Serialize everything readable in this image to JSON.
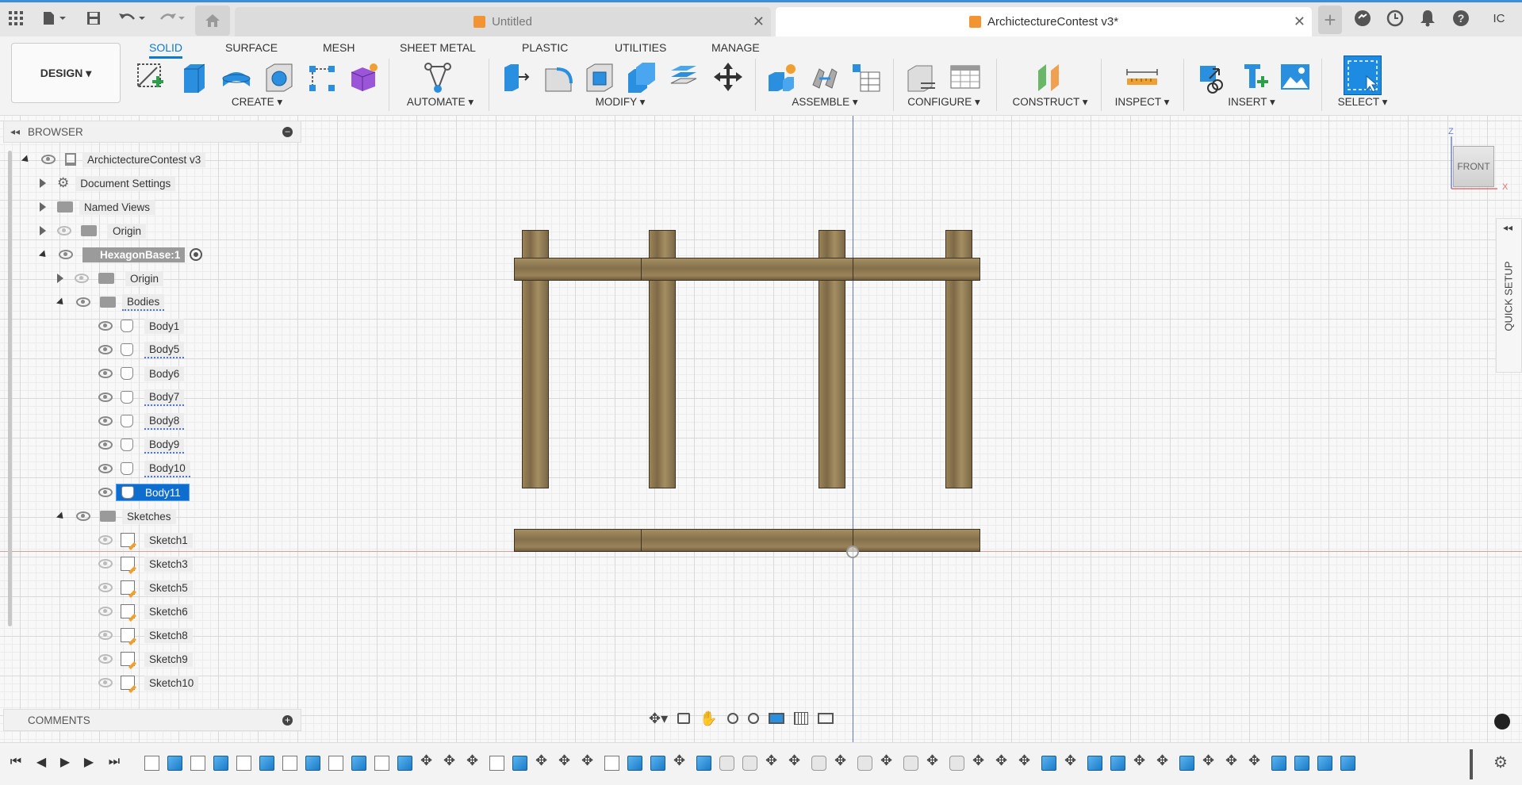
{
  "title_bar": {
    "tabs": [
      {
        "label": "Untitled",
        "active": false
      },
      {
        "label": "ArchictectureContest v3*",
        "active": true
      }
    ],
    "user_initials": "IC"
  },
  "toolbar": {
    "workspace": "DESIGN ▾",
    "workspace_tabs": [
      "SOLID",
      "SURFACE",
      "MESH",
      "SHEET METAL",
      "PLASTIC",
      "UTILITIES",
      "MANAGE"
    ],
    "active_tab": "SOLID",
    "groups": {
      "create": "CREATE ▾",
      "automate": "AUTOMATE ▾",
      "modify": "MODIFY ▾",
      "assemble": "ASSEMBLE ▾",
      "configure": "CONFIGURE ▾",
      "construct": "CONSTRUCT ▾",
      "inspect": "INSPECT ▾",
      "insert": "INSERT ▾",
      "select": "SELECT ▾"
    }
  },
  "browser": {
    "title": "BROWSER",
    "root": "ArchictectureContest v3",
    "document_settings": "Document Settings",
    "named_views": "Named Views",
    "origin": "Origin",
    "component": "HexagonBase:1",
    "component_origin": "Origin",
    "bodies_folder": "Bodies",
    "bodies": [
      "Body1",
      "Body5",
      "Body6",
      "Body7",
      "Body8",
      "Body9",
      "Body10",
      "Body11"
    ],
    "selected_body": "Body11",
    "sketches_folder": "Sketches",
    "sketches": [
      "Sketch1",
      "Sketch3",
      "Sketch5",
      "Sketch6",
      "Sketch8",
      "Sketch9",
      "Sketch10"
    ]
  },
  "comments": {
    "title": "COMMENTS"
  },
  "viewcube": {
    "face": "FRONT",
    "z": "Z",
    "x": "X"
  },
  "quick_setup": "QUICK SETUP",
  "colors": {
    "accent": "#0a7ad6",
    "selection": "#0f6ecd",
    "wood": "#8c7650",
    "tab_icon": "#f29432"
  }
}
